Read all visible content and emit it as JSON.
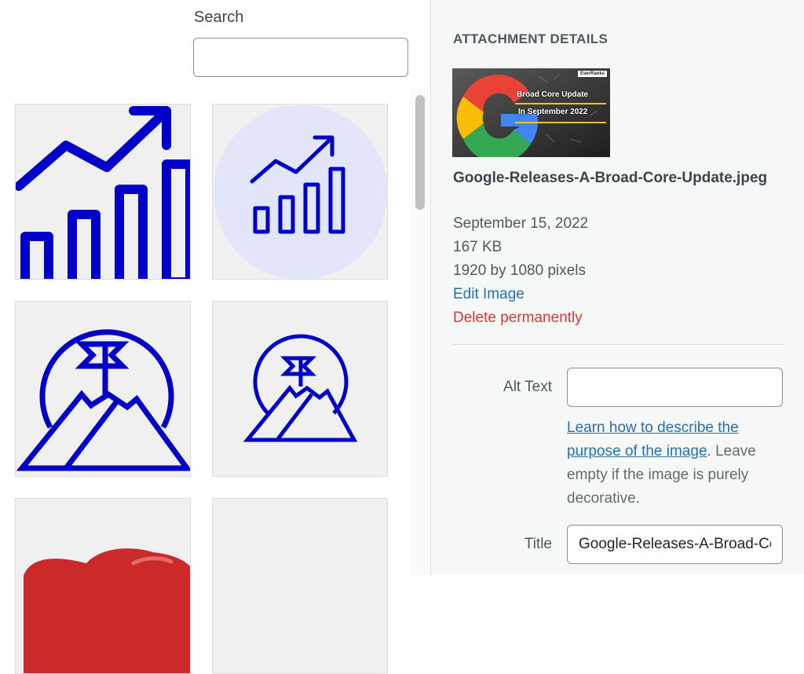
{
  "search": {
    "label": "Search",
    "value": "",
    "placeholder": ""
  },
  "grid": {
    "items": [
      {
        "icon": "growth-chart-icon",
        "selected": false
      },
      {
        "icon": "growth-chart-circle-icon",
        "selected": false
      },
      {
        "icon": "mountain-flag-icon",
        "selected": false
      },
      {
        "icon": "mountain-flag-small-icon",
        "selected": false
      },
      {
        "icon": "red-shape-image",
        "selected": false
      },
      {
        "icon": "blank-image",
        "selected": false
      }
    ]
  },
  "details": {
    "heading": "Attachment Details",
    "preview": {
      "badge": "EverRanks",
      "line1": "Broad Core Update",
      "line2": "In September 2022"
    },
    "file_name": "Google-Releases-A-Broad-Core-Update.jpeg",
    "date": "September 15, 2022",
    "size": "167 KB",
    "dimensions": "1920 by 1080 pixels",
    "edit_label": "Edit Image",
    "delete_label": "Delete permanently",
    "alt_text": {
      "label": "Alt Text",
      "value": ""
    },
    "help": {
      "link_text": "Learn how to describe the purpose of the image",
      "rest": ". Leave empty if the image is purely decorative."
    },
    "title": {
      "label": "Title",
      "value": "Google-Releases-A-Broad-Core-Update"
    }
  },
  "colors": {
    "icon_blue": "#0000c8",
    "link_blue": "#2271b1",
    "delete_red": "#d63638",
    "circle_tint": "#e3e6fb",
    "thumb_red": "#cc2a2a"
  }
}
